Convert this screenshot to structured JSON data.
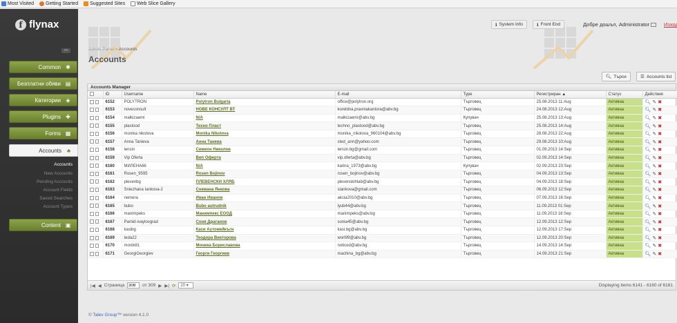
{
  "bookmarks": [
    {
      "label": "Most Visited",
      "icon": "bookmark-icon"
    },
    {
      "label": "Getting Started",
      "icon": "firefox-icon"
    },
    {
      "label": "Suggested Sites",
      "icon": "rss-icon"
    },
    {
      "label": "Web Slice Gallery",
      "icon": "page-icon"
    }
  ],
  "brand": {
    "name": "flynax",
    "logo_letter": "f"
  },
  "sidebar": {
    "collapse_label": "««",
    "items": [
      {
        "label": "Common",
        "icon": "gear-icon",
        "glyph": "✱"
      },
      {
        "label": "Безплатни обяви",
        "icon": "listings-icon",
        "glyph": "▤"
      },
      {
        "label": "Категории",
        "icon": "categories-icon",
        "glyph": "◈"
      },
      {
        "label": "Plugins",
        "icon": "puzzle-icon",
        "glyph": "✚"
      },
      {
        "label": "Forms",
        "icon": "forms-icon",
        "glyph": "▦"
      },
      {
        "label": "Accounts",
        "icon": "users-icon",
        "glyph": "♣"
      },
      {
        "label": "Content",
        "icon": "content-icon",
        "glyph": "▣"
      }
    ],
    "sub_items": [
      "Accounts",
      "New Accounts",
      "Pending Accounts",
      "Account Fields",
      "Saved Searches",
      "Account Types"
    ]
  },
  "header": {
    "system_info": "System Info",
    "front_end": "Front End",
    "welcome": "Добре дошъл, Administrator",
    "logout": "Изход"
  },
  "breadcrumb": {
    "root": "Admin Panel",
    "sep": "»",
    "current": "Accounts"
  },
  "page_title": "Accounts",
  "toolbar": {
    "search": "Търси",
    "list": "Accounts list"
  },
  "grid": {
    "title": "Accounts Manager",
    "columns": [
      "",
      "ID",
      "Username",
      "Name",
      "E-mail",
      "Type",
      "Регистриран ▲",
      "Статус",
      "Действия"
    ],
    "rows": [
      [
        "6152",
        "POLYTRON",
        "Polytron Bulgaria",
        "office@polytron.org",
        "Търговец",
        "25.08.2013 11:Aug",
        "Активна"
      ],
      [
        "6153",
        "noveconsult",
        "НОВЕ КОНСУЛТ ВТ",
        "koreldna.pravniakantora@abv.bg",
        "Търговец",
        "24.08.2013 12:Aug",
        "Активна"
      ],
      [
        "6154",
        "malkizaemi",
        "N/A",
        "malkizaemi@abv.bg",
        "Купувач",
        "25.08.2013 13:Aug",
        "Активна"
      ],
      [
        "6155",
        "plastood",
        "Техно Пласт",
        "techno_plastood@abv.bg",
        "Търговец",
        "25.08.2013 14:Aug",
        "Активна"
      ],
      [
        "6156",
        "monika nikolova",
        "Monika Nikolova",
        "monika_nikolova_960104@abv.bg",
        "Търговец",
        "28.08.2013 22:Aug",
        "Активна"
      ],
      [
        "6157",
        "Anna Tanieva",
        "Анна Танева",
        "sted_ann@yahoo.com",
        "Търговец",
        "29.08.2013 10:Aug",
        "Активна"
      ],
      [
        "6158",
        "lensin",
        "Симеон Николов",
        "lensin.bg@gmail.com",
        "Търговец",
        "01.09.2013 14:Sep",
        "Активна"
      ],
      [
        "6159",
        "Vip Oferta",
        "Вип Оферта",
        "vip.oferta@abv.bg",
        "Търговец",
        "02.09.2013 14:Sep",
        "Активна"
      ],
      [
        "6160",
        "МИЛЕНА66",
        "N/A",
        "karina_1973@abv.bg",
        "Купувач",
        "02.09.2013 23:Sep",
        "Активна"
      ],
      [
        "6161",
        "Rosen_9595",
        "Rosen Bojinov",
        "rosen_bojinov@abv.bg",
        "Търговец",
        "04.09.2013 13:Sep",
        "Активна"
      ],
      [
        "6162",
        "plevenbg",
        "ПЛЕВЕНСКИ ХЛЯБ",
        "plevenskihlab@abv.bg",
        "Търговец",
        "04.09.2013 18:Sep",
        "Активна"
      ],
      [
        "6163",
        "Sniezhana Iankova-2",
        "Снежана Янкова",
        "siankova@gmail.com",
        "Търговец",
        "06.09.2013 12:Sep",
        "Активна"
      ],
      [
        "6164",
        "nemera",
        "Иван Иванов",
        "akcia2010@abv.bg",
        "Търговец",
        "07.09.2013 16:Sep",
        "Активна"
      ],
      [
        "6165",
        "bubo",
        "Bubo autrudnik",
        "lyub44@abv.bg",
        "Търговец",
        "11.09.2013 01:Sep",
        "Активна"
      ],
      [
        "6166",
        "manimpeks",
        "Манимпекс ЕООД",
        "manimpeks@abv.bg",
        "Търговец",
        "11.09.2013 16:Sep",
        "Активна"
      ],
      [
        "6167",
        "Pamid-ivaylovgrad",
        "Соня Драганов",
        "sonia45@abv.bg",
        "Търговец",
        "12.09.2013 12:Sep",
        "Активна"
      ],
      [
        "6168",
        "kasibg",
        "Каси Аутомейкъгн",
        "kasi.bg@abv.bg",
        "Търговец",
        "12.09.2013 17:Sep",
        "Активна"
      ],
      [
        "6169",
        "teda22",
        "Теодора Викторова",
        "wort99@abv.bg",
        "Търговец",
        "12.09.2013 20:Sep",
        "Активна"
      ],
      [
        "6170",
        "monik81",
        "Моника Бориславова",
        "noticed@abv.bg",
        "Търговец",
        "14.09.2013 14:Sep",
        "Активна"
      ],
      [
        "6171",
        "GeorgiGeorgiev",
        "Георги Георгиев",
        "machina_bg@abv.bg",
        "Търговец",
        "14.09.2013 21:Sep",
        "Активна"
      ]
    ]
  },
  "pager": {
    "page_label": "Страница",
    "page": "308",
    "of_label": "от 309",
    "per_page": "20",
    "displaying": "Displaying items 6141 - 6160 of 6161"
  },
  "footer": {
    "copy": "©",
    "company": "Talev Group™",
    "version": "version 4.1.0"
  }
}
